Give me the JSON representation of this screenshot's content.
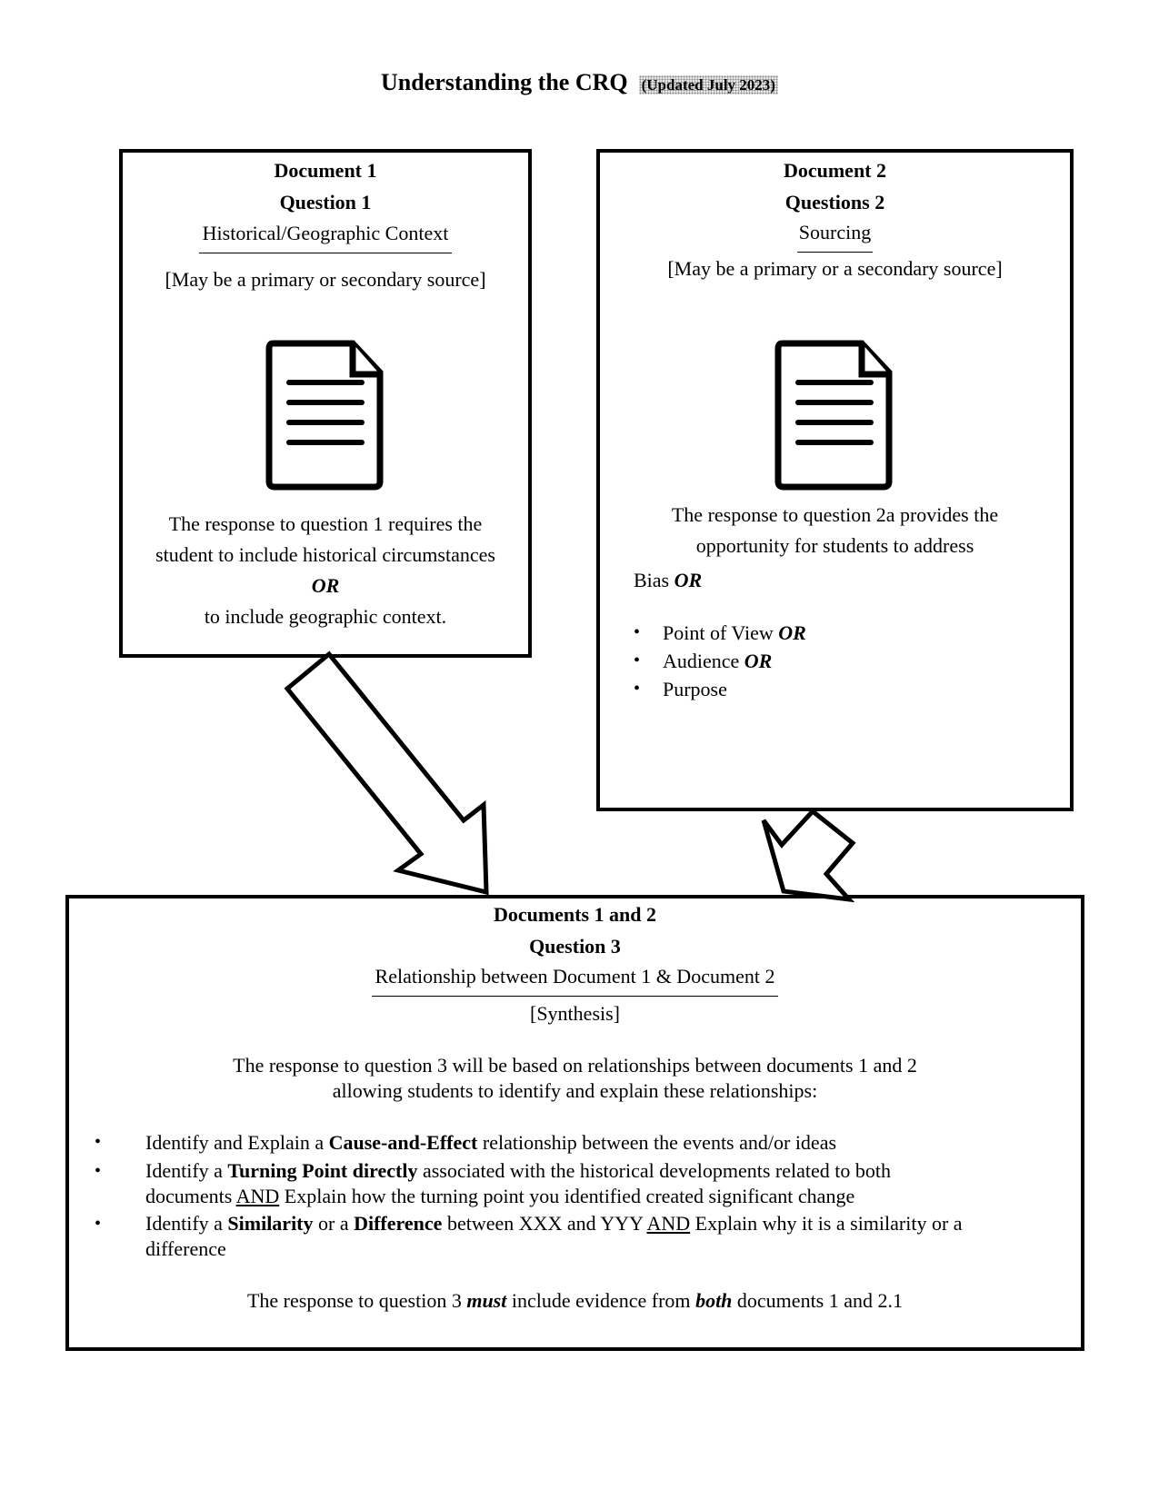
{
  "page": {
    "title": "Understanding the CRQ",
    "updated_badge": "(Updated July 2023)"
  },
  "document1": {
    "heading": "Document 1",
    "question": "Question 1",
    "skill": "Historical/Geographic Context",
    "source_note": "[May be a primary or secondary source]",
    "icon": "document-icon",
    "body_line1": "The response to question 1 requires the",
    "body_line2": "student to include historical circumstances",
    "or": "OR",
    "body_line3": "to include geographic context."
  },
  "document2": {
    "heading": "Document 2",
    "question": "Questions 2",
    "skill": "Sourcing",
    "source_note": "[May be a primary or a secondary source]",
    "icon": "document-icon",
    "body_line1": "The response to question 2a provides the",
    "body_line2": "opportunity for students to address",
    "bias_label": "Bias",
    "bias_or": "OR",
    "bullets": [
      {
        "text": "Point of View",
        "suffix": "OR"
      },
      {
        "text": "Audience",
        "suffix": "OR"
      },
      {
        "text": "Purpose",
        "suffix": ""
      }
    ]
  },
  "synthesis": {
    "heading": "Documents 1 and 2",
    "question": "Question 3",
    "skill": "Relationship between Document 1 & Document 2",
    "note": "[Synthesis]",
    "intro_line1": "The response to question 3 will be based on relationships between documents 1 and 2",
    "intro_line2": "allowing students to identify and explain these relationships:",
    "bullets": [
      {
        "a": "Identify and Explain a ",
        "b1": "Cause-and-Effect",
        "c": " relationship between the events and/or ideas"
      },
      {
        "a": "Identify a ",
        "b1": "Turning Point directly",
        "c": " associated with the historical developments related to both",
        "d": "documents ",
        "u": "AND",
        "e": " Explain how the turning point you identified created significant change"
      },
      {
        "a": "Identify a ",
        "b1": "Similarity",
        "m": " or a ",
        "b2": "Difference",
        "c": " between XXX and YYY ",
        "u": "AND",
        "e": " Explain why it is a similarity or a",
        "f": "difference"
      }
    ],
    "footer_a": "The response to question 3 ",
    "footer_must": "must",
    "footer_b": " include evidence from ",
    "footer_both": "both",
    "footer_c": " documents 1 and 2.1"
  }
}
